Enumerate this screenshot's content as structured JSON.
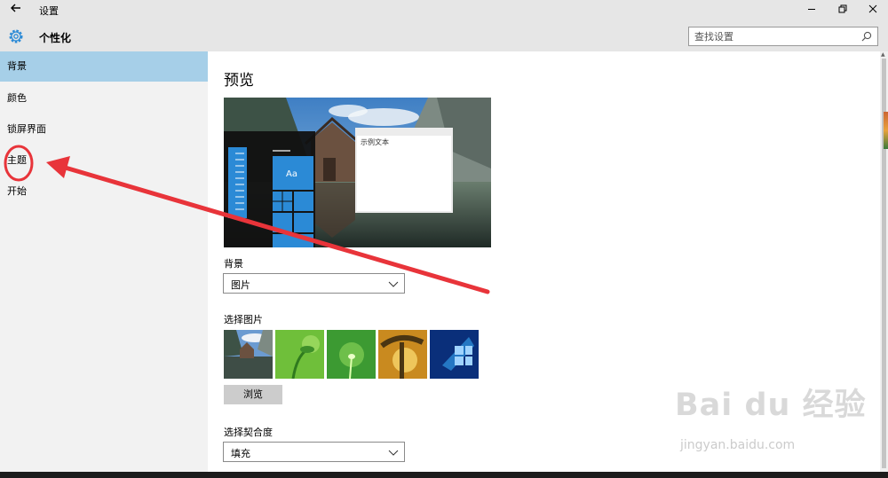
{
  "window": {
    "back_icon": "back-arrow-icon",
    "title": "设置",
    "controls": [
      "minimize-icon",
      "restore-icon",
      "close-icon"
    ]
  },
  "header": {
    "icon": "gear-icon",
    "page_title": "个性化",
    "search_placeholder": "查找设置",
    "search_icon": "search-icon"
  },
  "sidebar": {
    "items": [
      {
        "label": "背景",
        "active": true
      },
      {
        "label": "颜色",
        "active": false
      },
      {
        "label": "锁屏界面",
        "active": false
      },
      {
        "label": "主题",
        "active": false
      },
      {
        "label": "开始",
        "active": false
      }
    ]
  },
  "main": {
    "heading": "预览",
    "preview": {
      "sample_text": "示例文本",
      "tile_text": "Aa"
    },
    "background_label": "背景",
    "background_value": "图片",
    "choose_picture_label": "选择图片",
    "browse_label": "浏览",
    "fit_label": "选择契合度",
    "fit_value": "填充"
  },
  "annotation": {
    "color": "#e8343a",
    "target": "主题"
  },
  "watermark": {
    "brand": "Bai du 经验",
    "site": "jingyan.baidu.com"
  },
  "colors": {
    "accent": "#2b8ad6",
    "active_nav": "#a6cfe8",
    "chrome": "#e6e6e6",
    "sidebar_bg": "#f2f2f2"
  }
}
